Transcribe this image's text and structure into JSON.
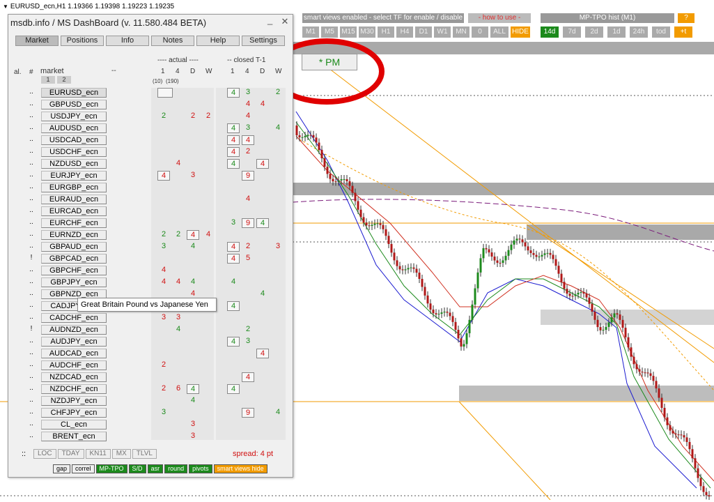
{
  "window_title": "EURUSD_ecn,H1  1.19366 1.19398 1.19223 1.19235",
  "panel": {
    "title": "msdb.info / MS DashBoard (v. 11.580.484 BETA)",
    "tabs": [
      "Market",
      "Positions",
      "Info",
      "Notes",
      "Help",
      "Settings"
    ],
    "col_al": "al.",
    "col_hash": "#",
    "col_market": "market",
    "col_dash": "--",
    "page1": "1",
    "page2": "2",
    "actual_label": "---- actual ----",
    "closed_label": "-- closed T-1",
    "tf_headers": [
      "1",
      "4",
      "D",
      "W"
    ],
    "closed_headers": [
      "1",
      "4",
      "D",
      "W"
    ],
    "sub10": "(10)",
    "sub190": "(190)",
    "rows": [
      {
        "mark": "..",
        "name": "EURUSD_ecn",
        "a": [
          {
            "v": "",
            "c": "box"
          },
          null,
          null,
          null
        ],
        "b": [
          {
            "v": "4",
            "c": "gbox"
          },
          {
            "v": "3",
            "c": "g"
          },
          null,
          {
            "v": "2",
            "c": "g"
          }
        ]
      },
      {
        "mark": "..",
        "name": "GBPUSD_ecn",
        "a": [
          null,
          null,
          null,
          null
        ],
        "b": [
          null,
          {
            "v": "4",
            "c": "r"
          },
          {
            "v": "4",
            "c": "r"
          },
          null
        ]
      },
      {
        "mark": "..",
        "name": "USDJPY_ecn",
        "a": [
          {
            "v": "2",
            "c": "g"
          },
          null,
          {
            "v": "2",
            "c": "r"
          },
          {
            "v": "2",
            "c": "r"
          }
        ],
        "b": [
          null,
          {
            "v": "4",
            "c": "r"
          },
          null,
          null
        ]
      },
      {
        "mark": "..",
        "name": "AUDUSD_ecn",
        "a": [
          null,
          null,
          null,
          null
        ],
        "b": [
          {
            "v": "4",
            "c": "gbox"
          },
          {
            "v": "3",
            "c": "g"
          },
          null,
          {
            "v": "4",
            "c": "g"
          }
        ]
      },
      {
        "mark": "..",
        "name": "USDCAD_ecn",
        "a": [
          null,
          null,
          null,
          null
        ],
        "b": [
          {
            "v": "4",
            "c": "rbox"
          },
          {
            "v": "4",
            "c": "rbox"
          },
          null,
          null
        ]
      },
      {
        "mark": "..",
        "name": "USDCHF_ecn",
        "a": [
          null,
          null,
          null,
          null
        ],
        "b": [
          {
            "v": "4",
            "c": "rbox"
          },
          {
            "v": "2",
            "c": "r"
          },
          null,
          null
        ]
      },
      {
        "mark": "..",
        "name": "NZDUSD_ecn",
        "a": [
          null,
          {
            "v": "4",
            "c": "r"
          },
          null,
          null
        ],
        "b": [
          {
            "v": "4",
            "c": "gbox"
          },
          null,
          {
            "v": "4",
            "c": "rbox"
          },
          null
        ]
      },
      {
        "mark": "..",
        "name": "EURJPY_ecn",
        "a": [
          {
            "v": "4",
            "c": "rbox"
          },
          null,
          {
            "v": "3",
            "c": "r"
          },
          null
        ],
        "b": [
          null,
          {
            "v": "9",
            "c": "rbox"
          },
          null,
          null
        ]
      },
      {
        "mark": "..",
        "name": "EURGBP_ecn",
        "a": [
          null,
          null,
          null,
          null
        ],
        "b": [
          null,
          null,
          null,
          null
        ]
      },
      {
        "mark": "..",
        "name": "EURAUD_ecn",
        "a": [
          null,
          null,
          null,
          null
        ],
        "b": [
          null,
          {
            "v": "4",
            "c": "r"
          },
          null,
          null
        ]
      },
      {
        "mark": "..",
        "name": "EURCAD_ecn",
        "a": [
          null,
          null,
          null,
          null
        ],
        "b": [
          null,
          null,
          null,
          null
        ]
      },
      {
        "mark": "..",
        "name": "EURCHF_ecn",
        "a": [
          null,
          null,
          null,
          null
        ],
        "b": [
          {
            "v": "3",
            "c": "g"
          },
          {
            "v": "9",
            "c": "rbox"
          },
          {
            "v": "4",
            "c": "gbox"
          },
          null
        ]
      },
      {
        "mark": "..",
        "name": "EURNZD_ecn",
        "a": [
          {
            "v": "2",
            "c": "g"
          },
          {
            "v": "2",
            "c": "g"
          },
          {
            "v": "4",
            "c": "rbox"
          },
          {
            "v": "4",
            "c": "r"
          }
        ],
        "b": [
          null,
          null,
          null,
          null
        ]
      },
      {
        "mark": "..",
        "name": "GBPAUD_ecn",
        "a": [
          {
            "v": "3",
            "c": "g"
          },
          null,
          {
            "v": "4",
            "c": "g"
          },
          null
        ],
        "b": [
          {
            "v": "4",
            "c": "rbox"
          },
          {
            "v": "2",
            "c": "r"
          },
          null,
          {
            "v": "3",
            "c": "r"
          }
        ]
      },
      {
        "mark": "!",
        "name": "GBPCAD_ecn",
        "a": [
          null,
          null,
          null,
          null
        ],
        "b": [
          {
            "v": "4",
            "c": "rbox"
          },
          {
            "v": "5",
            "c": "r"
          },
          null,
          null
        ]
      },
      {
        "mark": "..",
        "name": "GBPCHF_ecn",
        "a": [
          {
            "v": "4",
            "c": "r"
          },
          null,
          null,
          null
        ],
        "b": [
          null,
          null,
          null,
          null
        ]
      },
      {
        "mark": "..",
        "name": "GBPJPY_ecn",
        "a": [
          {
            "v": "4",
            "c": "r"
          },
          {
            "v": "4",
            "c": "r"
          },
          {
            "v": "4",
            "c": "g"
          },
          null
        ],
        "b": [
          {
            "v": "4",
            "c": "g"
          },
          null,
          null,
          null
        ]
      },
      {
        "mark": "..",
        "name": "GBPNZD_ecn",
        "a": [
          null,
          null,
          {
            "v": "4",
            "c": "r"
          },
          null
        ],
        "b": [
          null,
          null,
          {
            "v": "4",
            "c": "g"
          },
          null
        ]
      },
      {
        "mark": "..",
        "name": "CADJPY_ecn",
        "a": [
          null,
          null,
          null,
          null
        ],
        "b": [
          {
            "v": "4",
            "c": "gbox"
          },
          null,
          null,
          null
        ]
      },
      {
        "mark": "..",
        "name": "CADCHF_ecn",
        "a": [
          {
            "v": "3",
            "c": "r"
          },
          {
            "v": "3",
            "c": "r"
          },
          null,
          null
        ],
        "b": [
          null,
          null,
          null,
          null
        ]
      },
      {
        "mark": "!",
        "name": "AUDNZD_ecn",
        "a": [
          null,
          {
            "v": "4",
            "c": "g"
          },
          null,
          null
        ],
        "b": [
          null,
          {
            "v": "2",
            "c": "g"
          },
          null,
          null
        ]
      },
      {
        "mark": "..",
        "name": "AUDJPY_ecn",
        "a": [
          null,
          null,
          null,
          null
        ],
        "b": [
          {
            "v": "4",
            "c": "gbox"
          },
          {
            "v": "3",
            "c": "g"
          },
          null,
          null
        ]
      },
      {
        "mark": "..",
        "name": "AUDCAD_ecn",
        "a": [
          null,
          null,
          null,
          null
        ],
        "b": [
          null,
          null,
          {
            "v": "4",
            "c": "rbox"
          },
          null
        ]
      },
      {
        "mark": "..",
        "name": "AUDCHF_ecn",
        "a": [
          {
            "v": "2",
            "c": "r"
          },
          null,
          null,
          null
        ],
        "b": [
          null,
          null,
          null,
          null
        ]
      },
      {
        "mark": "..",
        "name": "NZDCAD_ecn",
        "a": [
          null,
          null,
          null,
          null
        ],
        "b": [
          null,
          {
            "v": "4",
            "c": "rbox"
          },
          null,
          null
        ]
      },
      {
        "mark": "..",
        "name": "NZDCHF_ecn",
        "a": [
          {
            "v": "2",
            "c": "r"
          },
          {
            "v": "6",
            "c": "r"
          },
          {
            "v": "4",
            "c": "gbox"
          },
          null
        ],
        "b": [
          {
            "v": "4",
            "c": "gbox"
          },
          null,
          null,
          null
        ]
      },
      {
        "mark": "..",
        "name": "NZDJPY_ecn",
        "a": [
          null,
          null,
          {
            "v": "4",
            "c": "g"
          },
          null
        ],
        "b": [
          null,
          null,
          null,
          null
        ]
      },
      {
        "mark": "..",
        "name": "CHFJPY_ecn",
        "a": [
          {
            "v": "3",
            "c": "g"
          },
          null,
          null,
          null
        ],
        "b": [
          null,
          {
            "v": "9",
            "c": "rbox"
          },
          null,
          {
            "v": "4",
            "c": "g"
          }
        ]
      },
      {
        "mark": "..",
        "name": "CL_ecn",
        "a": [
          null,
          null,
          {
            "v": "3",
            "c": "r"
          },
          null
        ],
        "b": [
          null,
          null,
          null,
          null
        ]
      },
      {
        "mark": "..",
        "name": "BRENT_ecn",
        "a": [
          null,
          null,
          {
            "v": "3",
            "c": "r"
          },
          null
        ],
        "b": [
          null,
          null,
          null,
          null
        ]
      }
    ],
    "bottom_buttons": [
      "LOC",
      "TDAY",
      "KN11",
      "MX",
      "TLVL"
    ],
    "bottom_prefix": "::",
    "spread": "spread: 4 pt",
    "tools": [
      {
        "label": "gap",
        "color": "#eeeeee",
        "text": "#000000"
      },
      {
        "label": "correl",
        "color": "#eeeeee",
        "text": "#000000"
      },
      {
        "label": "MP-TPO",
        "color": "#1c8a1c",
        "text": "#ffffff"
      },
      {
        "label": "S/D",
        "color": "#1c8a1c",
        "text": "#ffffff"
      },
      {
        "label": "asr",
        "color": "#1c8a1c",
        "text": "#ffffff"
      },
      {
        "label": "round",
        "color": "#1c8a1c",
        "text": "#ffffff"
      },
      {
        "label": "pivots",
        "color": "#1c8a1c",
        "text": "#ffffff"
      },
      {
        "label": "smart views hide",
        "color": "#f29b00",
        "text": "#ffffff"
      }
    ]
  },
  "tooltip": "Great Britain Pound vs Japanese Yen",
  "topbar": {
    "smart_views_label": "smart views enabled - select TF for enable / disable",
    "how_to_use": "- how to use -",
    "mp_tpo_label": "MP-TPO hist (M1)",
    "question": "?",
    "tf_buttons": [
      "M1",
      "M5",
      "M15",
      "M30",
      "H1",
      "H4",
      "D1",
      "W1",
      "MN",
      "0",
      "ALL",
      "HIDE"
    ],
    "tpo_buttons": [
      "14d",
      "7d",
      "2d",
      "1d",
      "24h",
      "tod",
      "+t"
    ]
  },
  "pm_button": "* PM",
  "colors": {
    "green": "#1c8a1c",
    "red": "#d01010",
    "orange": "#f29b00",
    "annotation": "#e00000"
  }
}
